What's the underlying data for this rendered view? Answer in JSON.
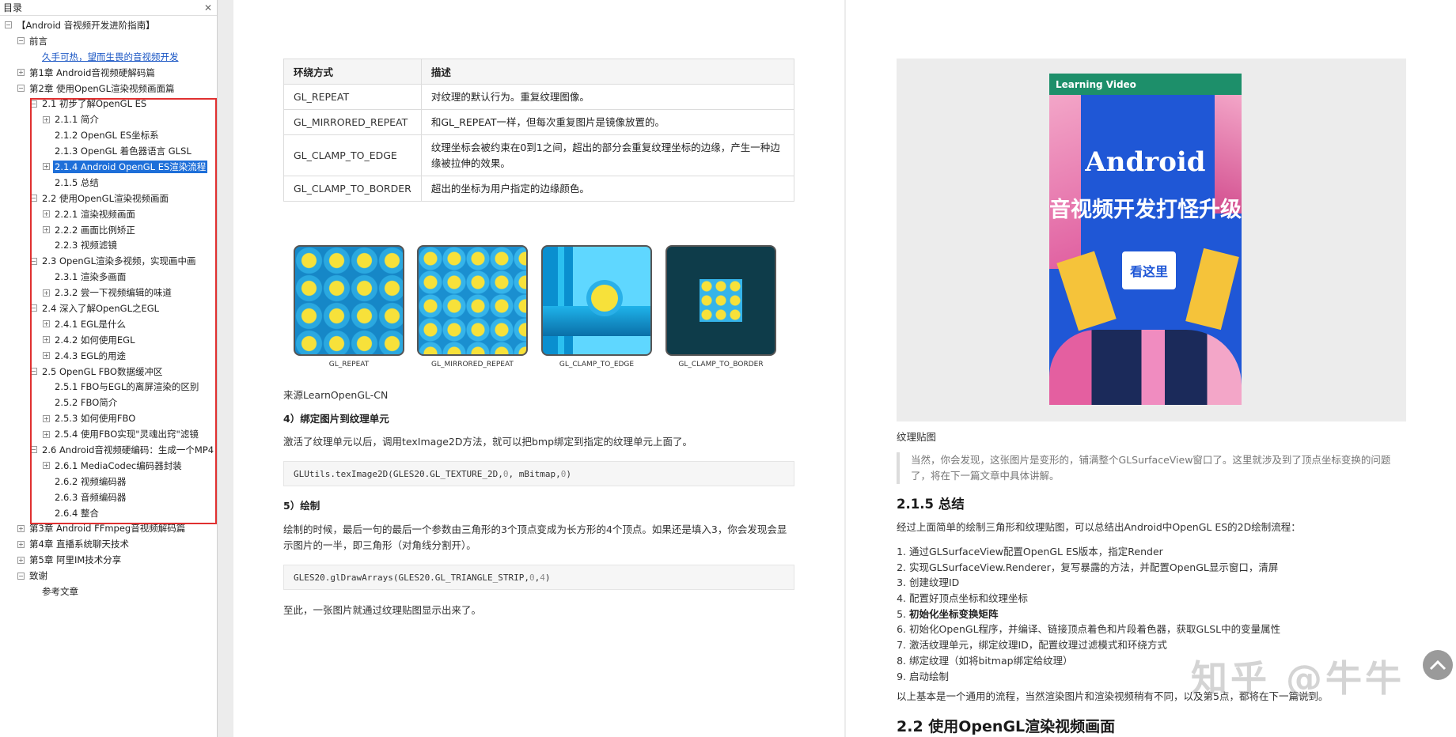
{
  "toc": {
    "header": "目录",
    "close_icon": "close-icon",
    "items": [
      {
        "label": "【Android 音视频开发进阶指南】",
        "level": 0,
        "toggle": "-"
      },
      {
        "label": "前言",
        "level": 1,
        "toggle": "-"
      },
      {
        "label": "久手可热，望而生畏的音视频开发",
        "level": 2,
        "toggle": "",
        "link": true
      },
      {
        "label": "第1章 Android音视频硬解码篇",
        "level": 1,
        "toggle": "+"
      },
      {
        "label": "第2章 使用OpenGL渲染视频画面篇",
        "level": 1,
        "toggle": "-"
      },
      {
        "label": "2.1 初步了解OpenGL ES",
        "level": 2,
        "toggle": "-"
      },
      {
        "label": "2.1.1 简介",
        "level": 3,
        "toggle": "+"
      },
      {
        "label": "2.1.2 OpenGL ES坐标系",
        "level": 3,
        "toggle": ""
      },
      {
        "label": "2.1.3 OpenGL 着色器语言 GLSL",
        "level": 3,
        "toggle": ""
      },
      {
        "label": "2.1.4 Android OpenGL ES渲染流程",
        "level": 3,
        "toggle": "+",
        "selected": true
      },
      {
        "label": "2.1.5 总结",
        "level": 3,
        "toggle": ""
      },
      {
        "label": "2.2 使用OpenGL渲染视频画面",
        "level": 2,
        "toggle": "-"
      },
      {
        "label": "2.2.1 渲染视频画面",
        "level": 3,
        "toggle": "+"
      },
      {
        "label": "2.2.2 画面比例矫正",
        "level": 3,
        "toggle": "+"
      },
      {
        "label": "2.2.3 视频滤镜",
        "level": 3,
        "toggle": ""
      },
      {
        "label": "2.3 OpenGL渲染多视频，实现画中画",
        "level": 2,
        "toggle": "-"
      },
      {
        "label": "2.3.1 渲染多画面",
        "level": 3,
        "toggle": ""
      },
      {
        "label": "2.3.2 尝一下视频编辑的味道",
        "level": 3,
        "toggle": "+"
      },
      {
        "label": "2.4 深入了解OpenGL之EGL",
        "level": 2,
        "toggle": "-"
      },
      {
        "label": "2.4.1 EGL是什么",
        "level": 3,
        "toggle": "+"
      },
      {
        "label": "2.4.2 如何使用EGL",
        "level": 3,
        "toggle": "+"
      },
      {
        "label": "2.4.3 EGL的用途",
        "level": 3,
        "toggle": "+"
      },
      {
        "label": "2.5 OpenGL FBO数据缓冲区",
        "level": 2,
        "toggle": "-"
      },
      {
        "label": "2.5.1 FBO与EGL的离屏渲染的区别",
        "level": 3,
        "toggle": ""
      },
      {
        "label": "2.5.2 FBO简介",
        "level": 3,
        "toggle": ""
      },
      {
        "label": "2.5.3 如何使用FBO",
        "level": 3,
        "toggle": "+"
      },
      {
        "label": "2.5.4 使用FBO实现\"灵魂出窍\"滤镜",
        "level": 3,
        "toggle": "+"
      },
      {
        "label": "2.6 Android音视频硬编码：生成一个MP4",
        "level": 2,
        "toggle": "-"
      },
      {
        "label": "2.6.1 MediaCodec编码器封装",
        "level": 3,
        "toggle": "+"
      },
      {
        "label": "2.6.2 视频编码器",
        "level": 3,
        "toggle": ""
      },
      {
        "label": "2.6.3 音频编码器",
        "level": 3,
        "toggle": ""
      },
      {
        "label": "2.6.4 整合",
        "level": 3,
        "toggle": ""
      },
      {
        "label": "第3章 Android FFmpeg音视频解码篇",
        "level": 1,
        "toggle": "+"
      },
      {
        "label": "第4章 直播系统聊天技术",
        "level": 1,
        "toggle": "+"
      },
      {
        "label": "第5章 阿里IM技术分享",
        "level": 1,
        "toggle": "+"
      },
      {
        "label": "致谢",
        "level": 1,
        "toggle": "-"
      },
      {
        "label": "参考文章",
        "level": 2,
        "toggle": ""
      }
    ]
  },
  "page1": {
    "table": {
      "headers": [
        "环绕方式",
        "描述"
      ],
      "rows": [
        [
          "GL_REPEAT",
          "对纹理的默认行为。重复纹理图像。"
        ],
        [
          "GL_MIRRORED_REPEAT",
          "和GL_REPEAT一样，但每次重复图片是镜像放置的。"
        ],
        [
          "GL_CLAMP_TO_EDGE",
          "纹理坐标会被约束在0到1之间，超出的部分会重复纹理坐标的边缘，产生一种边缘被拉伸的效果。"
        ],
        [
          "GL_CLAMP_TO_BORDER",
          "超出的坐标为用户指定的边缘颜色。"
        ]
      ]
    },
    "textures": [
      "GL_REPEAT",
      "GL_MIRRORED_REPEAT",
      "GL_CLAMP_TO_EDGE",
      "GL_CLAMP_TO_BORDER"
    ],
    "source": "来源LearnOpenGL-CN",
    "step4_title": "4）绑定图片到纹理单元",
    "step4_text": "激活了纹理单元以后，调用texImage2D方法，就可以把bmp绑定到指定的纹理单元上面了。",
    "code1": {
      "pre": "GLUtils.texImage2D(GLES20.GL_TEXTURE_2D, ",
      "n1": "0",
      "mid": ", mBitmap, ",
      "n2": "0",
      "post": ")"
    },
    "step5_title": "5）绘制",
    "step5_text": "绘制的时候，最后一句的最后一个参数由三角形的3个顶点变成为长方形的4个顶点。如果还是填入3，你会发现会显示图片的一半，即三角形（对角线分割开）。",
    "code2": {
      "pre": "GLES20.glDrawArrays(GLES20.GL_TRIANGLE_STRIP, ",
      "n1": "0",
      "mid": ", ",
      "n2": "4",
      "post": ")"
    },
    "closing": "至此，一张图片就通过纹理贴图显示出来了。"
  },
  "page2": {
    "cover": {
      "badge": "Learning Video",
      "title1": "Android",
      "title2": "音视频开发打怪升级",
      "button": "看这里"
    },
    "fig_caption": "纹理贴图",
    "quote": "当然，你会发现，这张图片是变形的，铺满整个GLSurfaceView窗口了。这里就涉及到了顶点坐标变换的问题了，将在下一篇文章中具体讲解。",
    "heading": "2.1.5 总结",
    "intro": "经过上面简单的绘制三角形和纹理贴图，可以总结出Android中OpenGL ES的2D绘制流程：",
    "steps": [
      "通过GLSurfaceView配置OpenGL ES版本，指定Render",
      "实现GLSurfaceView.Renderer，复写暴露的方法，并配置OpenGL显示窗口，清屏",
      "创建纹理ID",
      "配置好顶点坐标和纹理坐标",
      "初始化坐标变换矩阵",
      "初始化OpenGL程序，并编译、链接顶点着色和片段着色器，获取GLSL中的变量属性",
      "激活纹理单元，绑定纹理ID，配置纹理过滤模式和环绕方式",
      "绑定纹理（如将bitmap绑定给纹理）",
      "启动绘制"
    ],
    "bold_step_index": 4,
    "outro": "以上基本是一个通用的流程，当然渲染图片和渲染视频稍有不同，以及第5点，都将在下一篇说到。",
    "next_heading": "2.2 使用OpenGL渲染视频画面"
  },
  "watermark": "知乎 @牛牛",
  "colors": {
    "selection": "#1e6fd9",
    "highlight_box": "#e03030",
    "link": "#1a56c4",
    "cover_bg": "#1f57d6"
  }
}
